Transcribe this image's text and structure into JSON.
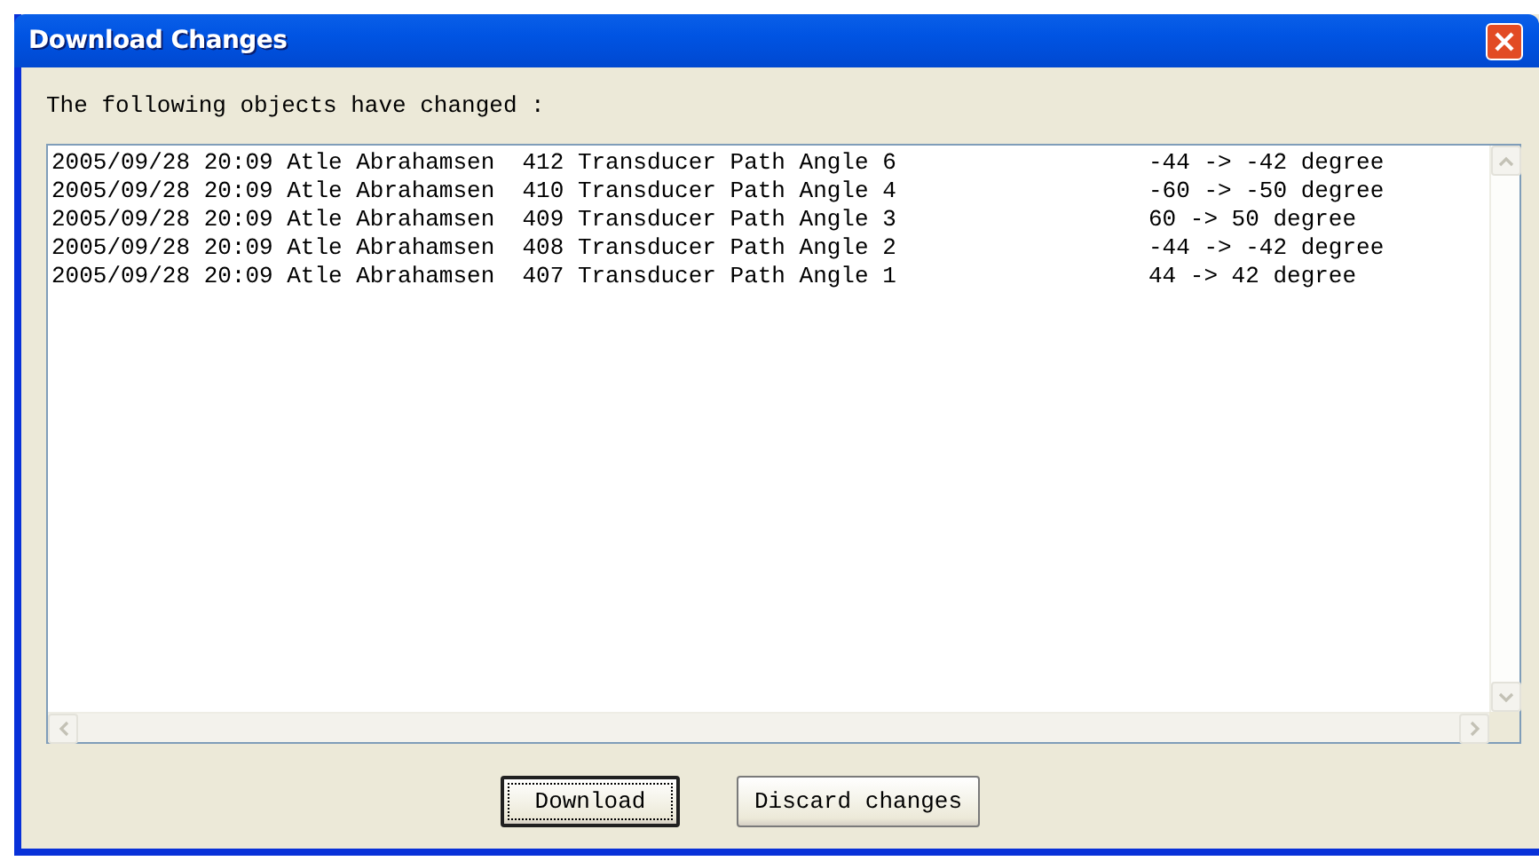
{
  "window": {
    "title": "Download Changes"
  },
  "message": "The following objects have changed :",
  "list": {
    "rows": [
      {
        "entry": "2005/09/28 20:09 Atle Abrahamsen  412 Transducer Path Angle 6",
        "change": "-44 -> -42 degree"
      },
      {
        "entry": "2005/09/28 20:09 Atle Abrahamsen  410 Transducer Path Angle 4",
        "change": "-60 -> -50 degree"
      },
      {
        "entry": "2005/09/28 20:09 Atle Abrahamsen  409 Transducer Path Angle 3",
        "change": "60 -> 50 degree"
      },
      {
        "entry": "2005/09/28 20:09 Atle Abrahamsen  408 Transducer Path Angle 2",
        "change": "-44 -> -42 degree"
      },
      {
        "entry": "2005/09/28 20:09 Atle Abrahamsen  407 Transducer Path Angle 1",
        "change": "44 -> 42 degree"
      }
    ]
  },
  "buttons": [
    {
      "label": "Download",
      "default": true
    },
    {
      "label": "Discard changes",
      "default": false
    }
  ]
}
